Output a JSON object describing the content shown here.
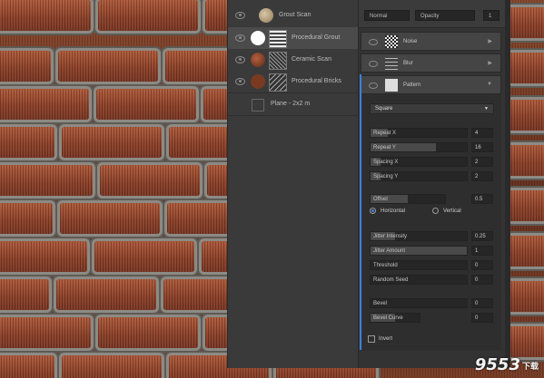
{
  "layers": [
    {
      "name": "Grout Scan",
      "selected": false
    },
    {
      "name": "Procedural Grout",
      "selected": true
    },
    {
      "name": "Ceramic Scan",
      "selected": false
    },
    {
      "name": "Procedural Bricks",
      "selected": false
    },
    {
      "name": "Plane - 2x2 m",
      "selected": false
    }
  ],
  "properties": {
    "blend_mode": "Normal",
    "opacity_label": "Opacity",
    "opacity_value": "1",
    "effects": [
      {
        "label": "Noise",
        "icon": "noise-icon"
      },
      {
        "label": "Blur",
        "icon": "blur-icon"
      },
      {
        "label": "Pattern",
        "icon": "pattern-icon"
      }
    ],
    "pattern_type": "Square",
    "sliders": [
      {
        "label": "Repeat X",
        "value": "4",
        "fill": 0.18
      },
      {
        "label": "Repeat Y",
        "value": "16",
        "fill": 0.68
      },
      {
        "label": "Spacing X",
        "value": "2",
        "fill": 0.1
      },
      {
        "label": "Spacing Y",
        "value": "2",
        "fill": 0.1
      },
      {
        "label": "Offset",
        "value": "0.5",
        "fill": 0.5
      },
      {
        "label": "Jitter Intensity",
        "value": "0.25",
        "fill": 0.25
      },
      {
        "label": "Jitter Amount",
        "value": "1",
        "fill": 1.0
      },
      {
        "label": "Threshold",
        "value": "0",
        "fill": 0
      },
      {
        "label": "Random Seed",
        "value": "0",
        "fill": 0
      },
      {
        "label": "Bevel",
        "value": "0",
        "fill": 0
      },
      {
        "label": "Bevel Curve",
        "value": "0",
        "fill": 0.5
      }
    ],
    "radio_horizontal": "Horizontal",
    "radio_vertical": "Vertical",
    "invert_label": "Invert"
  },
  "watermark": {
    "text": "9553",
    "suffix": "下载"
  },
  "colors": {
    "accent": "#3b7fe0",
    "panel": "#333333"
  }
}
